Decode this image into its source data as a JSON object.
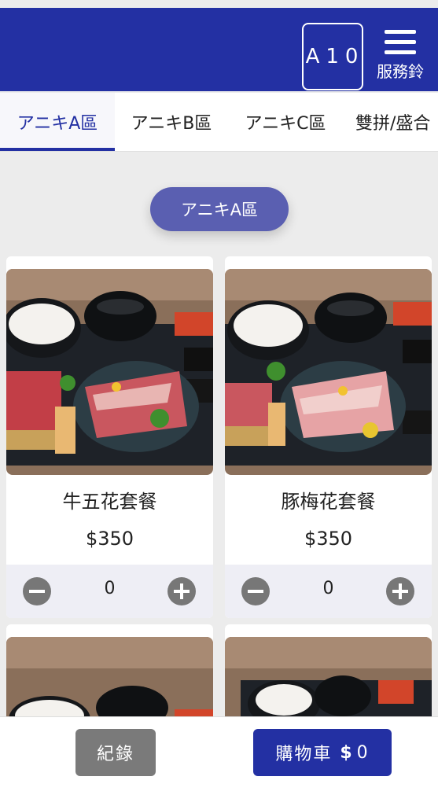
{
  "header": {
    "table_number": "A10",
    "service_label": "服務鈴"
  },
  "tabs": [
    {
      "label": "アニキA區",
      "active": true
    },
    {
      "label": "アニキB區",
      "active": false
    },
    {
      "label": "アニキC區",
      "active": false
    },
    {
      "label": "雙拼/盛合",
      "active": false
    }
  ],
  "section": {
    "title": "アニキA區"
  },
  "products": [
    {
      "name": "牛五花套餐",
      "price": "$350",
      "quantity": "0",
      "image": "beef-set-photo"
    },
    {
      "name": "豚梅花套餐",
      "price": "$350",
      "quantity": "0",
      "image": "pork-set-photo"
    },
    {
      "name": "",
      "price": "",
      "quantity": "",
      "image": "set-photo"
    },
    {
      "name": "",
      "price": "",
      "quantity": "",
      "image": "set-photo"
    }
  ],
  "bottom": {
    "history_label": "紀錄",
    "cart_label": "購物車",
    "cart_currency_symbol": "$",
    "cart_total": "0"
  },
  "colors": {
    "primary": "#2330a3",
    "pill": "#5a5fb1",
    "secondary_button": "#7a7a7a"
  }
}
